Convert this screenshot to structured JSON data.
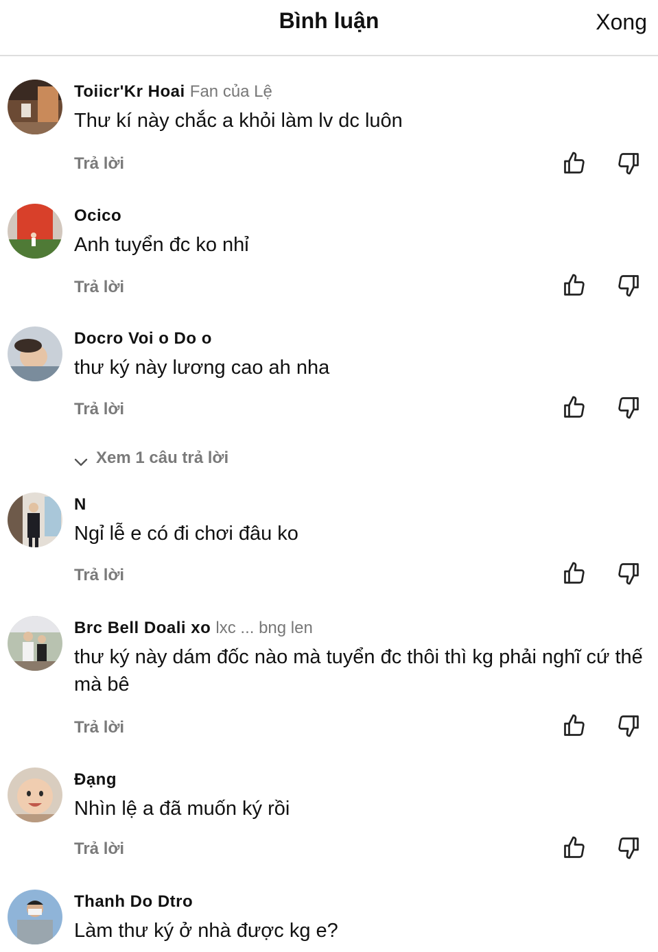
{
  "header": {
    "title": "Bình luận",
    "done_label": "Xong"
  },
  "reply_label": "Trả lời",
  "comments": [
    {
      "username": "Toiicr'Kr Hoai",
      "badge": "Fan của Lệ",
      "text": "Thư kí này chắc a khỏi làm lv dc luôn"
    },
    {
      "username": "Ocico",
      "badge": "",
      "text": "Anh tuyển đc ko nhỉ"
    },
    {
      "username": "Docro Voi o Do o",
      "badge": "",
      "text": "thư ký này lương cao ah nha",
      "view_replies": "Xem 1 câu trả lời"
    },
    {
      "username": "N",
      "badge": "",
      "text": "Ngỉ lễ e có đi chơi đâu ko"
    },
    {
      "username": "Brc Bell Doali xo",
      "badge": "lxc ... bng len",
      "text": "thư ký này dám đốc nào mà tuyển đc thôi thì kg phải nghĩ cứ thế mà bê"
    },
    {
      "username": "Đạng",
      "badge": "",
      "text": "Nhìn lệ a đã muốn ký rồi"
    },
    {
      "username": "Thanh Do Dtro",
      "badge": "",
      "text": "Làm thư ký ở nhà được kg e?"
    }
  ],
  "icons": {
    "like": "thumbs-up-icon",
    "dislike": "thumbs-down-icon",
    "chevron": "chevron-down-icon"
  },
  "colors": {
    "text": "#111111",
    "muted": "#7a7a7a",
    "divider": "#dedede"
  }
}
